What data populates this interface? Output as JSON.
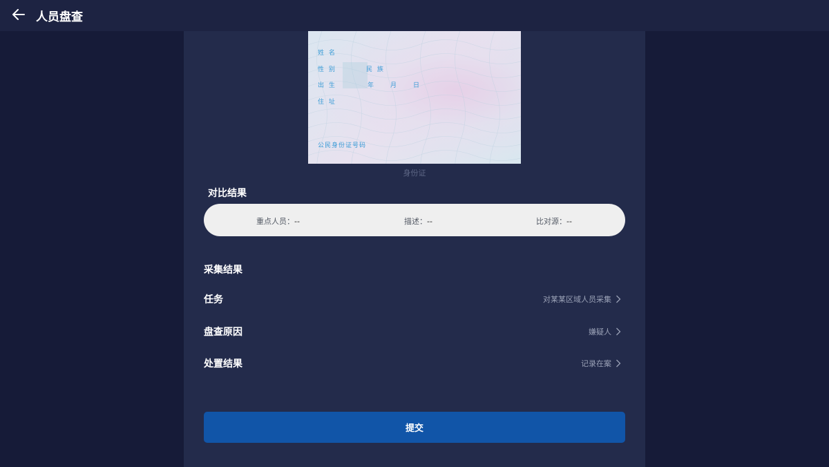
{
  "header": {
    "title": "人员盘查",
    "back_icon": "arrow-left-icon"
  },
  "id_card": {
    "fields": {
      "name": "姓 名",
      "gender": "性 别",
      "ethnicity": "民 族",
      "birth": "出 生",
      "year": "年",
      "month": "月",
      "day": "日",
      "address": "住 址",
      "id_number": "公民身份证号码"
    },
    "caption": "身份证",
    "text_color": "#3a9bd6"
  },
  "compare": {
    "title": "对比结果",
    "items": [
      {
        "label": "重点人员：",
        "value": "--"
      },
      {
        "label": "描述：",
        "value": "--"
      },
      {
        "label": "比对源：",
        "value": "--"
      }
    ]
  },
  "collect": {
    "title": "采集结果",
    "rows": [
      {
        "label": "任务",
        "value": "对某某区域人员采集",
        "icon": "chevron-right-icon"
      },
      {
        "label": "盘查原因",
        "value": "嫌疑人",
        "icon": "chevron-right-icon"
      },
      {
        "label": "处置结果",
        "value": "记录在案",
        "icon": "chevron-right-icon"
      }
    ]
  },
  "submit": {
    "label": "提交",
    "color": "#1155a8"
  }
}
